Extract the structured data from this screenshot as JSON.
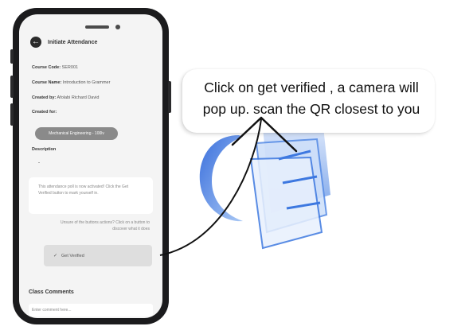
{
  "screen": {
    "title": "Initiate Attendance",
    "fields": [
      {
        "label": "Course Code:",
        "value": "SER001"
      },
      {
        "label": "Course Name:",
        "value": "Introduction to Grammer"
      },
      {
        "label": "Created by:",
        "value": "Afolabi Richard David"
      },
      {
        "label": "Created for:",
        "value": ""
      }
    ],
    "created_for_chip": "Mechanical Engineering - 100lv",
    "description_label": "Description",
    "description_value": "-",
    "notice_text": "This attendance poll is now activated! Click the Get Verified button to mark yourself in.",
    "hint_text": "Unsure of the buttons actions? Click on a button to discover what it does",
    "verify_button_label": "Get Verified",
    "comments_title": "Class Comments",
    "comment_placeholder": "Enter comment here..."
  },
  "callout": {
    "text": "Click on get verified , a camera will pop up. scan the QR closest to you"
  },
  "icons": {
    "back": "arrow-left-icon",
    "check": "check-icon",
    "decoration": "blue-qr-logo"
  },
  "colors": {
    "phone_frame": "#1b1b1d",
    "screen_bg": "#f4f4f4",
    "chip_bg": "#8a8a8a",
    "decoration_blue": "#4a86e8"
  }
}
